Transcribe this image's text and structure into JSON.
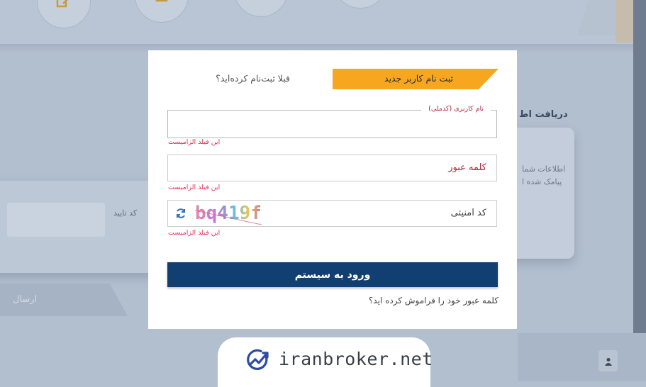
{
  "background": {
    "left_card_label": "کد تایید",
    "left_send_label": "ارسال",
    "right_card_title": "دریافت اط",
    "right_card_line1": "اطلاعات شما",
    "right_card_line2": "پیامک شده ا"
  },
  "modal": {
    "tabs": {
      "register_label": "ثبت نام کاربر جدید",
      "login_label": "قبلا ثبت‌نام کرده‌اید؟",
      "active_color": "#f6a71f"
    },
    "username": {
      "label": "نام کاربری (کدملی)",
      "value": "",
      "error": "این فیلد الزامیست"
    },
    "password": {
      "placeholder": "کلمه عبور",
      "value": "",
      "error": "این فیلد الزامیست"
    },
    "captcha": {
      "placeholder": "کد امنیتی",
      "value": "",
      "captcha_text": "bq419f",
      "refresh_icon": "refresh-icon",
      "error": "این فیلد الزامیست"
    },
    "submit_label": "ورود به سیستم",
    "submit_color": "#123f72",
    "forgot_password": "کلمه عبور خود را فراموش کرده اید؟"
  },
  "watermark": {
    "text": "iranbroker.net",
    "icon": "chart-trend-icon"
  }
}
